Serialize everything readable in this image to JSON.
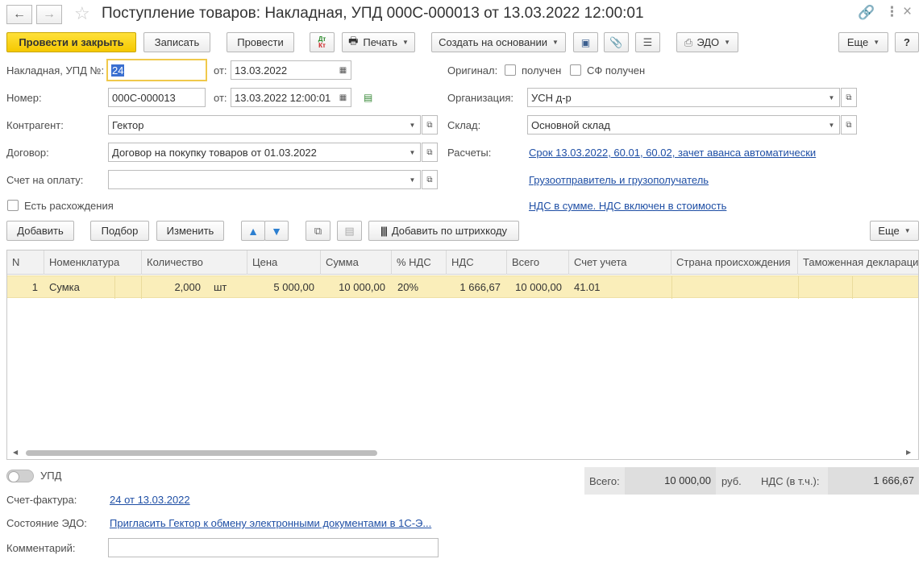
{
  "window": {
    "title": "Поступление товаров: Накладная, УПД 000С-000013 от 13.03.2022 12:00:01",
    "back_icon": "←",
    "forward_icon": "→"
  },
  "toolbar": {
    "post_close": "Провести и закрыть",
    "write": "Записать",
    "post": "Провести",
    "dt_kt": "Дт\nКт",
    "print": "Печать",
    "create_based": "Создать на основании",
    "edo": "ЭДО",
    "more": "Еще",
    "help": "?"
  },
  "form": {
    "invoice_label": "Накладная, УПД №:",
    "invoice_value": "24",
    "from_label": "от:",
    "invoice_date": "13.03.2022",
    "number_label": "Номер:",
    "number_value": "000С-000013",
    "number_date": "13.03.2022 12:00:01",
    "counterparty_label": "Контрагент:",
    "counterparty_value": "Гектор",
    "contract_label": "Договор:",
    "contract_value": "Договор на покупку товаров от 01.03.2022",
    "payment_label": "Счет на оплату:",
    "payment_value": "",
    "discrepancy_label": "Есть расхождения",
    "original_label": "Оригинал:",
    "received_label": "получен",
    "sf_received_label": "СФ получен",
    "org_label": "Организация:",
    "org_value": "УСН д-р",
    "warehouse_label": "Склад:",
    "warehouse_value": "Основной склад",
    "settlements_label": "Расчеты:",
    "settlements_link": "Срок 13.03.2022, 60.01, 60.02, зачет аванса автоматически",
    "shipper_link": "Грузоотправитель и грузополучатель",
    "vat_link": "НДС в сумме. НДС включен в стоимость"
  },
  "table_toolbar": {
    "add": "Добавить",
    "pick": "Подбор",
    "change": "Изменить",
    "barcode": "Добавить по штрихкоду",
    "more": "Еще"
  },
  "table": {
    "columns": [
      "N",
      "Номенклатура",
      "Количество",
      "Цена",
      "Сумма",
      "% НДС",
      "НДС",
      "Всего",
      "Счет учета",
      "Страна происхождения",
      "Таможенная деклараци"
    ],
    "rows": [
      {
        "n": "1",
        "item": "Сумка",
        "qty": "2,000",
        "unit": "шт",
        "price": "5 000,00",
        "sum": "10 000,00",
        "vat_rate": "20%",
        "vat": "1 666,67",
        "total": "10 000,00",
        "account": "41.01",
        "country": "",
        "customs": ""
      }
    ]
  },
  "footer": {
    "upd_label": "УПД",
    "total_label": "Всего:",
    "total_value": "10 000,00",
    "currency": "руб.",
    "vat_label": "НДС (в т.ч.):",
    "vat_value": "1 666,67",
    "sf_label": "Счет-фактура:",
    "sf_link": "24 от 13.03.2022",
    "edo_label": "Состояние ЭДО:",
    "edo_link": "Пригласить Гектор к обмену электронными документами в 1С-Э...",
    "comment_label": "Комментарий:",
    "comment_value": ""
  }
}
